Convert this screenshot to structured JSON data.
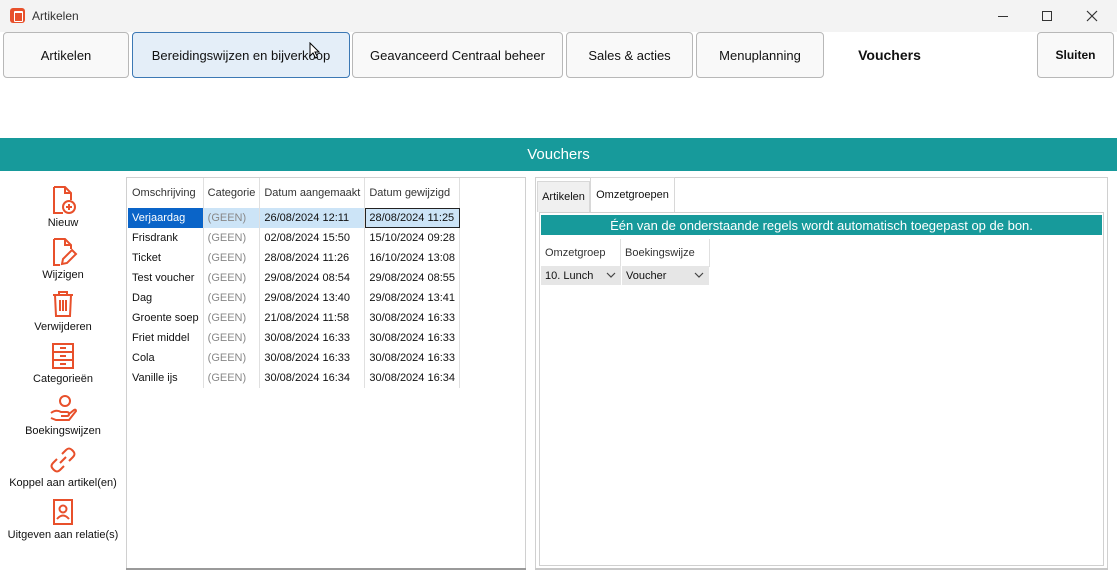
{
  "window": {
    "title": "Artikelen"
  },
  "top_tabs": {
    "artikelen": "Artikelen",
    "bereidingswijzen": "Bereidingswijzen en bijverkoop",
    "geavanceerd": "Geavanceerd Centraal beheer",
    "sales": "Sales & acties",
    "menuplanning": "Menuplanning",
    "vouchers": "Vouchers",
    "sluiten": "Sluiten"
  },
  "section_title": "Vouchers",
  "toolbar": [
    {
      "label": "Nieuw",
      "icon": "new-document-icon"
    },
    {
      "label": "Wijzigen",
      "icon": "edit-document-icon"
    },
    {
      "label": "Verwijderen",
      "icon": "trash-icon"
    },
    {
      "label": "Categorieën",
      "icon": "cabinet-icon"
    },
    {
      "label": "Boekingswijzen",
      "icon": "hand-coin-icon"
    },
    {
      "label": "Koppel aan artikel(en)",
      "icon": "link-icon"
    },
    {
      "label": "Uitgeven aan relatie(s)",
      "icon": "contact-icon"
    }
  ],
  "table": {
    "columns": [
      "Omschrijving",
      "Categorie",
      "Datum aangemaakt",
      "Datum gewijzigd"
    ],
    "rows": [
      [
        "Verjaardag",
        "(GEEN)",
        "26/08/2024 12:11",
        "28/08/2024 11:25"
      ],
      [
        "Frisdrank",
        "(GEEN)",
        "02/08/2024 15:50",
        "15/10/2024 09:28"
      ],
      [
        "Ticket",
        "(GEEN)",
        "28/08/2024 11:26",
        "16/10/2024 13:08"
      ],
      [
        "Test voucher",
        "(GEEN)",
        "29/08/2024 08:54",
        "29/08/2024 08:55"
      ],
      [
        "Dag",
        "(GEEN)",
        "29/08/2024 13:40",
        "29/08/2024 13:41"
      ],
      [
        "Groente soep",
        "(GEEN)",
        "21/08/2024 11:58",
        "30/08/2024 16:33"
      ],
      [
        "Friet middel",
        "(GEEN)",
        "30/08/2024 16:33",
        "30/08/2024 16:33"
      ],
      [
        "Cola",
        "(GEEN)",
        "30/08/2024 16:33",
        "30/08/2024 16:33"
      ],
      [
        "Vanille ijs",
        "(GEEN)",
        "30/08/2024 16:34",
        "30/08/2024 16:34"
      ]
    ],
    "selected_row": 0
  },
  "right_panel": {
    "tabs": [
      "Artikelen",
      "Omzetgroepen"
    ],
    "active_tab": "Omzetgroepen",
    "info_text": "Één van de onderstaande regels wordt automatisch toegepast op de bon.",
    "columns": [
      "Omzetgroep",
      "Boekingswijze"
    ],
    "row": {
      "omzetgroep": "10. Lunch",
      "boekingswijze": "Voucher"
    }
  },
  "colors": {
    "accent": "#179a9b",
    "icon": "#e8502b",
    "selection": "#0a64c8",
    "active_tab_border": "#3c78b4"
  }
}
